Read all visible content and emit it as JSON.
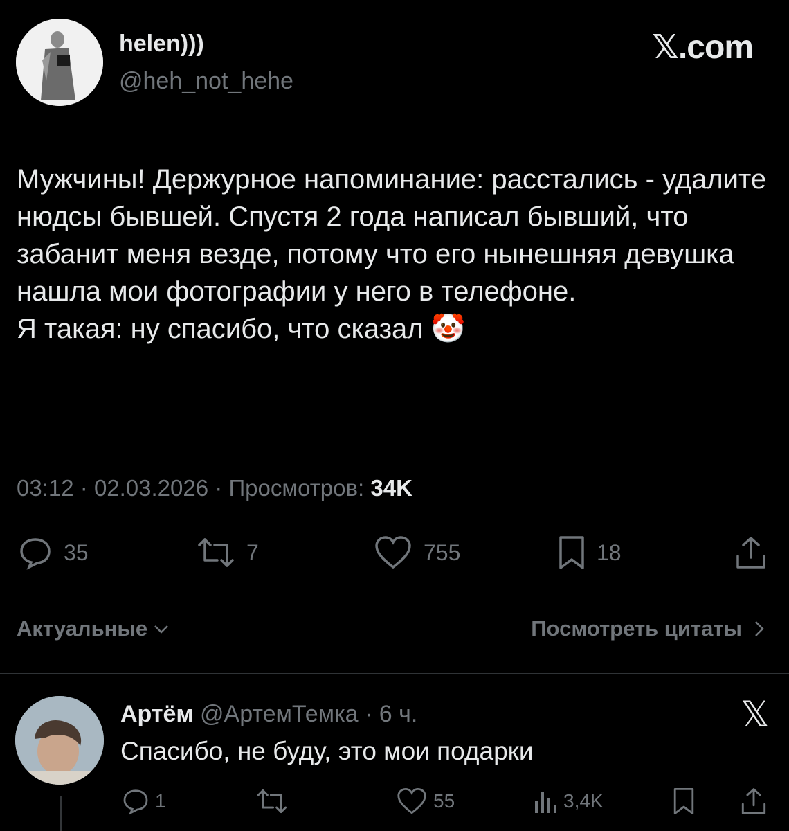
{
  "post": {
    "author_name": "helen)))",
    "author_handle": "@heh_not_hehe",
    "brand": "𝕏.com",
    "text": "Мужчины! Держурное напоминание: расстались - удалите нюдсы бывшей. Спустя 2 года написал бывший, что забанит меня везде, потому что его нынешняя девушка нашла мои фотографии у него в телефоне.\nЯ такая: ну спасибо, что сказал 🤡",
    "time": "03:12",
    "date": "02.03.2026",
    "views_label": "Просмотров:",
    "views": "34K",
    "actions": {
      "replies": "35",
      "reposts": "7",
      "likes": "755",
      "bookmarks": "18"
    }
  },
  "tabs": {
    "sort_label": "Актуальные",
    "quotes_label": "Посмотреть цитаты"
  },
  "reply": {
    "author_name": "Артём",
    "author_handle": "@АртемТемка",
    "age": "6 ч.",
    "text": "Спасибо, не буду, это мои подарки",
    "actions": {
      "replies": "1",
      "likes": "55",
      "views": "3,4K"
    }
  }
}
